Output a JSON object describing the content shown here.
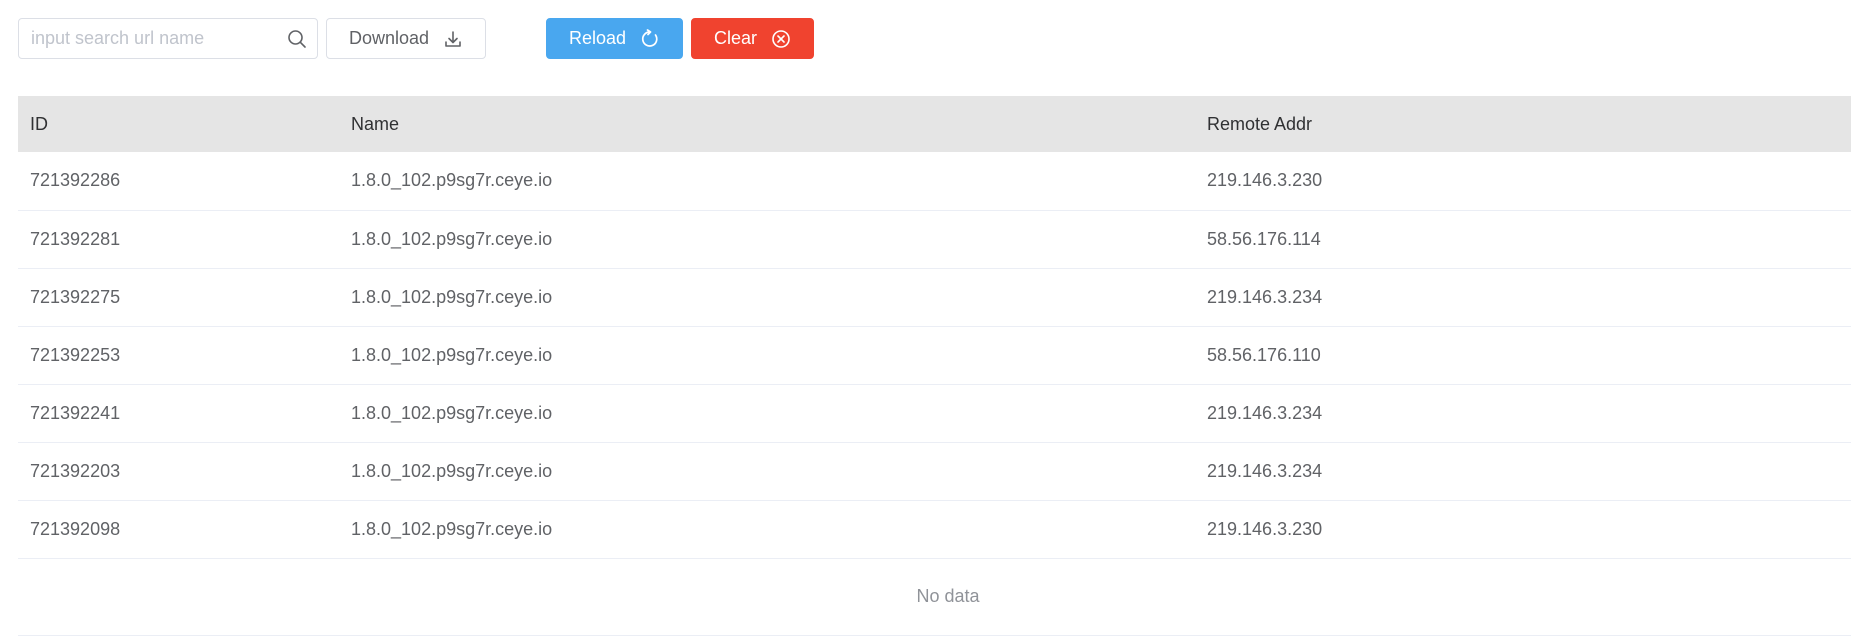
{
  "toolbar": {
    "search": {
      "placeholder": "input search url name",
      "value": ""
    },
    "download_label": "Download",
    "reload_label": "Reload",
    "clear_label": "Clear",
    "icons": {
      "search": "search-icon",
      "download": "download-icon",
      "reload": "reload-icon",
      "clear": "close-circle-icon"
    },
    "colors": {
      "reload": "#49a7ef",
      "clear": "#f0432f"
    }
  },
  "table": {
    "columns": [
      "ID",
      "Name",
      "Remote Addr"
    ],
    "rows": [
      {
        "id": "721392286",
        "name": "1.8.0_102.p9sg7r.ceye.io",
        "addr": "219.146.3.230"
      },
      {
        "id": "721392281",
        "name": "1.8.0_102.p9sg7r.ceye.io",
        "addr": "58.56.176.114"
      },
      {
        "id": "721392275",
        "name": "1.8.0_102.p9sg7r.ceye.io",
        "addr": "219.146.3.234"
      },
      {
        "id": "721392253",
        "name": "1.8.0_102.p9sg7r.ceye.io",
        "addr": "58.56.176.110"
      },
      {
        "id": "721392241",
        "name": "1.8.0_102.p9sg7r.ceye.io",
        "addr": "219.146.3.234"
      },
      {
        "id": "721392203",
        "name": "1.8.0_102.p9sg7r.ceye.io",
        "addr": "219.146.3.234"
      },
      {
        "id": "721392098",
        "name": "1.8.0_102.p9sg7r.ceye.io",
        "addr": "219.146.3.230"
      }
    ],
    "empty_text": "No data"
  }
}
